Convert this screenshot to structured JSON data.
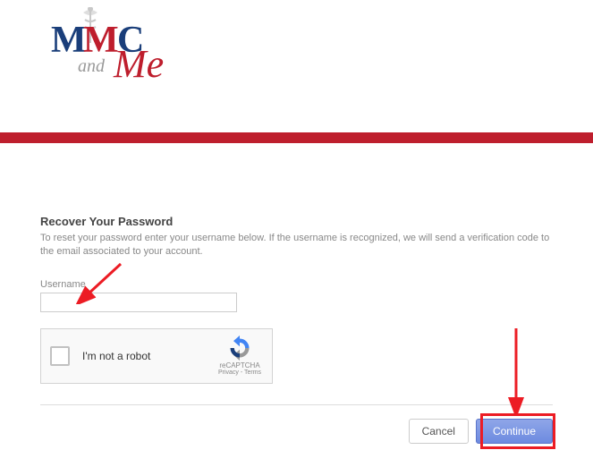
{
  "logo": {
    "alt": "MMC and Me"
  },
  "page": {
    "heading": "Recover Your Password",
    "description": "To reset your password enter your username below. If the username is recognized, we will send a verification code to the email associated to your account."
  },
  "form": {
    "username_label": "Username",
    "username_value": ""
  },
  "captcha": {
    "label": "I'm not a robot",
    "brand": "reCAPTCHA",
    "links": "Privacy - Terms"
  },
  "buttons": {
    "cancel": "Cancel",
    "continue": "Continue"
  }
}
